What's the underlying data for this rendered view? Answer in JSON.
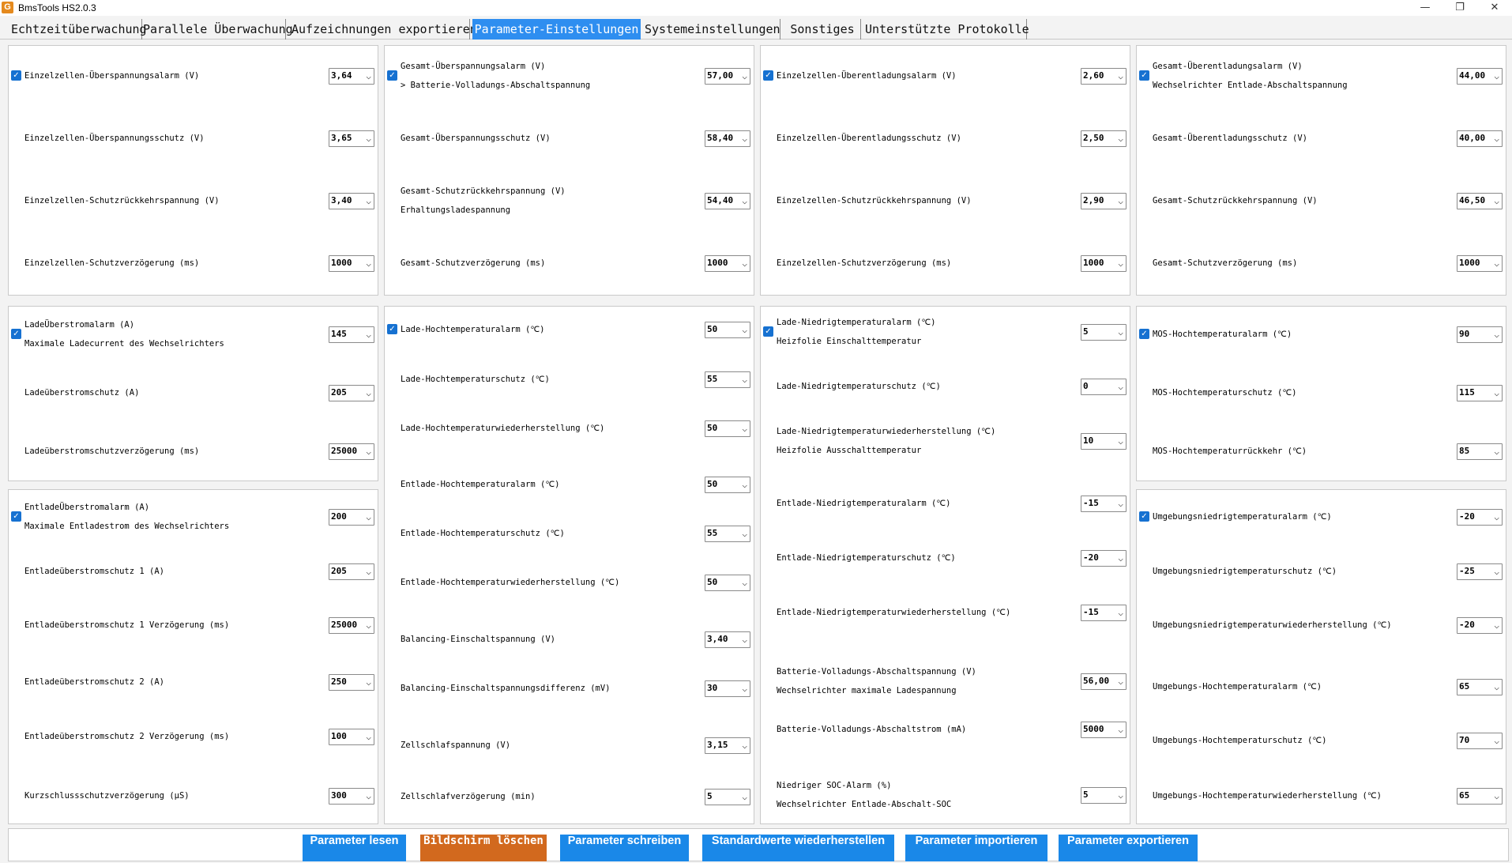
{
  "app": {
    "title": "BmsTools HS2.0.3",
    "icon_letter": "G",
    "controls": {
      "minimize": "—",
      "maximize": "❐",
      "close": "✕"
    }
  },
  "tabs": [
    {
      "label": "Echtzeitüberwachung"
    },
    {
      "label": "Parallele Überwachung"
    },
    {
      "label": "Aufzeichnungen exportieren"
    },
    {
      "label": "Parameter-Einstellungen",
      "active": true
    },
    {
      "label": "Systemeinstellungen"
    },
    {
      "label": "Sonstiges"
    },
    {
      "label": "Unterstützte Protokolle"
    }
  ],
  "colors": {
    "accent": "#2e8ef0",
    "button": "#1a88e8",
    "clear_button": "#d2691e",
    "checkbox": "#1671d1"
  },
  "panels": {
    "cell_overvoltage": {
      "rows": [
        {
          "label": "Einzelzellen-Überspannungsalarm (V)",
          "value": "3,64",
          "checked": true
        },
        {
          "label": "Einzelzellen-Überspannungsschutz (V)",
          "value": "3,65"
        },
        {
          "label": "Einzelzellen-Schutzrückkehrspannung (V)",
          "value": "3,40"
        },
        {
          "label": "Einzelzellen-Schutzverzögerung (ms)",
          "value": "1000"
        }
      ]
    },
    "pack_overvoltage": {
      "rows": [
        {
          "label": "Gesamt-Überspannungsalarm (V)",
          "sublabel": "> Batterie-Volladungs-Abschaltspannung",
          "value": "57,00",
          "checked": true
        },
        {
          "label": "Gesamt-Überspannungsschutz (V)",
          "value": "58,40"
        },
        {
          "label": "Gesamt-Schutzrückkehrspannung (V)",
          "sublabel": "Erhaltungsladespannung",
          "value": "54,40"
        },
        {
          "label": "Gesamt-Schutzverzögerung (ms)",
          "value": "1000"
        }
      ]
    },
    "cell_undervoltage": {
      "rows": [
        {
          "label": "Einzelzellen-Überentladungsalarm (V)",
          "value": "2,60",
          "checked": true
        },
        {
          "label": "Einzelzellen-Überentladungsschutz (V)",
          "value": "2,50"
        },
        {
          "label": "Einzelzellen-Schutzrückkehrspannung (V)",
          "value": "2,90"
        },
        {
          "label": "Einzelzellen-Schutzverzögerung (ms)",
          "value": "1000"
        }
      ]
    },
    "pack_undervoltage": {
      "rows": [
        {
          "label": "Gesamt-Überentladungsalarm (V)",
          "sublabel": "Wechselrichter Entlade-Abschaltspannung",
          "value": "44,00",
          "checked": true
        },
        {
          "label": "Gesamt-Überentladungsschutz (V)",
          "value": "40,00"
        },
        {
          "label": "Gesamt-Schutzrückkehrspannung (V)",
          "value": "46,50"
        },
        {
          "label": "Gesamt-Schutzverzögerung (ms)",
          "value": "1000"
        }
      ]
    },
    "charge_overcurrent": {
      "rows": [
        {
          "label": "LadeÜberstromalarm (A)",
          "sublabel": "Maximale Ladecurrent des Wechselrichters",
          "value": "145",
          "checked": true
        },
        {
          "label": "Ladeüberstromschutz (A)",
          "value": "205"
        },
        {
          "label": "Ladeüberstromschutzverzögerung (ms)",
          "value": "25000"
        }
      ]
    },
    "discharge_overcurrent": {
      "rows": [
        {
          "label": "EntladeÜberstromalarm (A)",
          "sublabel": "Maximale Entladestrom des Wechselrichters",
          "value": "200",
          "checked": true
        },
        {
          "label": "Entladeüberstromschutz 1 (A)",
          "value": "205"
        },
        {
          "label": "Entladeüberstromschutz 1 Verzögerung (ms)",
          "value": "25000"
        },
        {
          "label": "Entladeüberstromschutz 2 (A)",
          "value": "250"
        },
        {
          "label": "Entladeüberstromschutz 2 Verzögerung (ms)",
          "value": "100"
        },
        {
          "label": "Kurzschlussschutzverzögerung (μS)",
          "value": "300"
        }
      ]
    },
    "high_temperature": {
      "rows": [
        {
          "label": "Lade-Hochtemperaturalarm (℃)",
          "value": "50",
          "checked": true
        },
        {
          "label": "Lade-Hochtemperaturschutz (℃)",
          "value": "55"
        },
        {
          "label": "Lade-Hochtemperaturwiederherstellung (℃)",
          "value": "50"
        },
        {
          "label": "Entlade-Hochtemperaturalarm (℃)",
          "value": "50"
        },
        {
          "label": "Entlade-Hochtemperaturschutz (℃)",
          "value": "55"
        },
        {
          "label": "Entlade-Hochtemperaturwiederherstellung (℃)",
          "value": "50"
        },
        {
          "label": "Balancing-Einschaltspannung (V)",
          "value": "3,40"
        },
        {
          "label": "Balancing-Einschaltspannungsdifferenz (mV)",
          "value": "30"
        },
        {
          "label": "Zellschlafspannung (V)",
          "value": "3,15"
        },
        {
          "label": "Zellschlafverzögerung (min)",
          "value": "5"
        }
      ]
    },
    "low_temperature": {
      "rows": [
        {
          "label": "Lade-Niedrigtemperaturalarm (℃)",
          "sublabel": "Heizfolie Einschalttemperatur",
          "value": "5",
          "checked": true
        },
        {
          "label": "Lade-Niedrigtemperaturschutz (℃)",
          "value": "0"
        },
        {
          "label": "Lade-Niedrigtemperaturwiederherstellung (℃)",
          "sublabel": "Heizfolie Ausschalttemperatur",
          "value": "10"
        },
        {
          "label": "Entlade-Niedrigtemperaturalarm (℃)",
          "value": "-15"
        },
        {
          "label": "Entlade-Niedrigtemperaturschutz (℃)",
          "value": "-20"
        },
        {
          "label": "Entlade-Niedrigtemperaturwiederherstellung (℃)",
          "value": "-15"
        },
        {
          "label": "Batterie-Volladungs-Abschaltspannung (V)",
          "sublabel": "Wechselrichter maximale Ladespannung",
          "value": "56,00"
        },
        {
          "label": "Batterie-Volladungs-Abschaltstrom (mA)",
          "value": "5000"
        },
        {
          "label": "Niedriger SOC-Alarm (%)",
          "sublabel": "Wechselrichter Entlade-Abschalt-SOC",
          "value": "5"
        }
      ]
    },
    "mos_temperature": {
      "rows": [
        {
          "label": "MOS-Hochtemperaturalarm (℃)",
          "value": "90",
          "checked": true
        },
        {
          "label": "MOS-Hochtemperaturschutz (℃)",
          "value": "115"
        },
        {
          "label": "MOS-Hochtemperaturrückkehr (℃)",
          "value": "85"
        }
      ]
    },
    "ambient_temperature": {
      "rows": [
        {
          "label": "Umgebungsniedrigtemperaturalarm (℃)",
          "value": "-20",
          "checked": true
        },
        {
          "label": "Umgebungsniedrigtemperaturschutz (℃)",
          "value": "-25"
        },
        {
          "label": "Umgebungsniedrigtemperaturwiederherstellung (℃)",
          "value": "-20"
        },
        {
          "label": "Umgebungs-Hochtemperaturalarm (℃)",
          "value": "65"
        },
        {
          "label": "Umgebungs-Hochtemperaturschutz (℃)",
          "value": "70"
        },
        {
          "label": "Umgebungs-Hochtemperaturwiederherstellung (℃)",
          "value": "65"
        }
      ]
    }
  },
  "buttons": {
    "read": "Parameter lesen",
    "clear": "Bildschirm löschen",
    "write": "Parameter schreiben",
    "restore": "Standardwerte wiederherstellen",
    "import": "Parameter importieren",
    "export": "Parameter exportieren"
  }
}
